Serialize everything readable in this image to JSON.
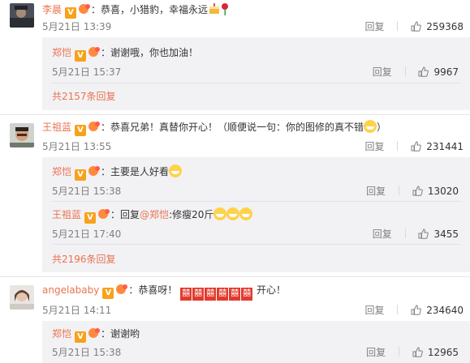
{
  "comments": [
    {
      "user": "李晨",
      "text": "恭喜，小猎豹，幸福永远",
      "time": "5月21日 13:39",
      "reply_label": "回复",
      "likes": "259368",
      "replies": [
        {
          "user": "郑恺",
          "text": "谢谢哦，你也加油！",
          "time": "5月21日 15:37",
          "reply_label": "回复",
          "likes": "9967"
        }
      ],
      "more_label": "共2157条回复"
    },
    {
      "user": "王祖蓝",
      "text": "恭喜兄弟！真替你开心！（顺便说一句：你的图修的真不错",
      "text_end": "）",
      "time": "5月21日 13:55",
      "reply_label": "回复",
      "likes": "231441",
      "replies": [
        {
          "user": "郑恺",
          "text": "主要是人好看",
          "time": "5月21日 15:38",
          "reply_label": "回复",
          "likes": "13020"
        },
        {
          "user": "王祖蓝",
          "text_prefix": "回复",
          "mention": "@郑恺",
          "text": ":修瘦20斤",
          "time": "5月21日 17:40",
          "reply_label": "回复",
          "likes": "3455"
        }
      ],
      "more_label": "共2196条回复"
    },
    {
      "user": "angelababy",
      "text": "恭喜呀！",
      "xi_char": "囍",
      "text_end": "开心！",
      "time": "5月21日 14:11",
      "reply_label": "回复",
      "likes": "234640",
      "replies": [
        {
          "user": "郑恺",
          "text": "谢谢哟",
          "time": "5月21日 15:38",
          "reply_label": "回复",
          "likes": "12965"
        }
      ]
    }
  ],
  "badges": {
    "v": "V"
  },
  "colors": {
    "name": "#eb7350",
    "sub_bg": "#f2f2f5",
    "muted": "#808080"
  },
  "icons": [
    "thumbs-up-icon",
    "verified-v-icon",
    "fan-badge-icon",
    "grin-emoji-icon",
    "cake-icon",
    "rose-icon",
    "double-happiness-icon"
  ]
}
